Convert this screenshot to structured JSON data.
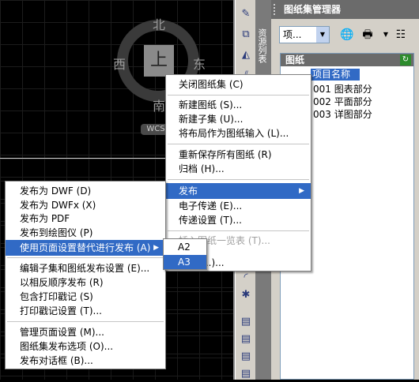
{
  "viewcube": {
    "north": "北",
    "south": "南",
    "east": "东",
    "west": "西",
    "top": "上",
    "wcs": "WCS"
  },
  "sheet_manager": {
    "title": "图纸集管理器",
    "palette_tab": "资源列表",
    "combo_value": "项...",
    "section_title": "图纸",
    "tree": [
      {
        "label": "项目名称",
        "selected": true
      },
      {
        "label": "001 图表部分"
      },
      {
        "label": "002 平面部分"
      },
      {
        "label": "003 详图部分"
      }
    ]
  },
  "context_menu": {
    "items": [
      {
        "label": "关闭图纸集 (C)"
      },
      {
        "label": "新建图纸 (S)..."
      },
      {
        "label": "新建子集 (U)..."
      },
      {
        "label": "将布局作为图纸输入 (L)..."
      },
      {
        "label": "重新保存所有图纸 (R)"
      },
      {
        "label": "归档 (H)..."
      },
      {
        "label": "发布",
        "highlighted": true
      },
      {
        "label": "电子传递 (E)..."
      },
      {
        "label": "传递设置 (T)..."
      },
      {
        "label": "插入图纸一览表 (T)...",
        "disabled": true
      },
      {
        "label": "...)..."
      }
    ]
  },
  "publish_menu": {
    "items": [
      {
        "label": "发布为 DWF (D)"
      },
      {
        "label": "发布为 DWFx (X)"
      },
      {
        "label": "发布为 PDF"
      },
      {
        "label": "发布到绘图仪 (P)"
      },
      {
        "label": "使用页面设置替代进行发布 (A)",
        "highlighted": true
      },
      {
        "label": "编辑子集和图纸发布设置 (E)..."
      },
      {
        "label": "以相反顺序发布 (R)"
      },
      {
        "label": "包含打印戳记 (S)"
      },
      {
        "label": "打印戳记设置 (T)..."
      },
      {
        "label": "管理页面设置 (M)..."
      },
      {
        "label": "图纸集发布选项 (O)..."
      },
      {
        "label": "发布对话框 (B)..."
      }
    ]
  },
  "override_menu": {
    "items": [
      {
        "label": "A2"
      },
      {
        "label": "A3",
        "highlighted": true
      }
    ]
  },
  "colors": {
    "highlight": "#316ac5",
    "panel": "#d4d0c8",
    "header": "#6b6b6b"
  }
}
